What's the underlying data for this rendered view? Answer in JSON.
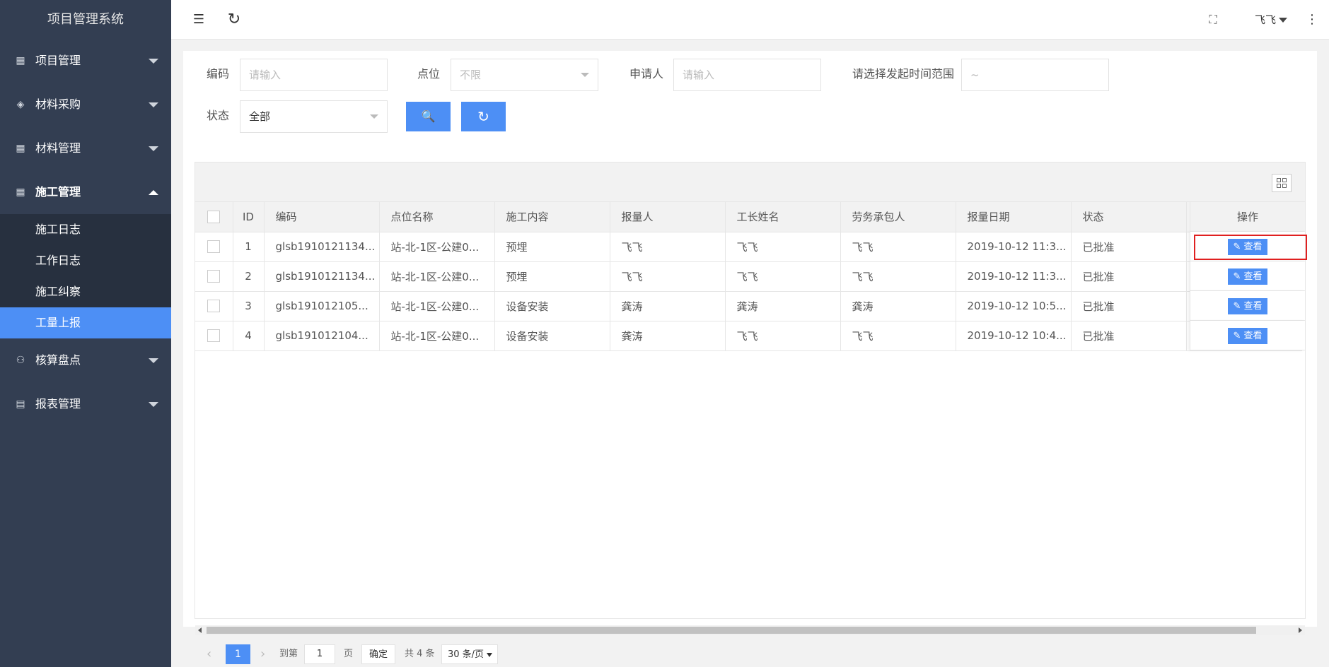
{
  "app": {
    "title": "项目管理系统"
  },
  "sidebar": {
    "menus": [
      {
        "label": "项目管理",
        "icon": "project-icon",
        "glyph": "▦",
        "open": false
      },
      {
        "label": "材料采购",
        "icon": "layers-icon",
        "glyph": "◈",
        "open": false
      },
      {
        "label": "材料管理",
        "icon": "material-icon",
        "glyph": "▦",
        "open": false
      },
      {
        "label": "施工管理",
        "icon": "construction-icon",
        "glyph": "▦",
        "open": true
      },
      {
        "label": "核算盘点",
        "icon": "user-icon",
        "glyph": "⚇",
        "open": false
      },
      {
        "label": "报表管理",
        "icon": "report-icon",
        "glyph": "▤",
        "open": false
      }
    ],
    "submenu": [
      "施工日志",
      "工作日志",
      "施工纠察",
      "工量上报"
    ],
    "active_sub": "工量上报"
  },
  "header": {
    "user": "飞飞",
    "menu_glyph": "☰",
    "refresh_glyph": "↻",
    "fullscreen_glyph": "⛶",
    "more_glyph": "⋮"
  },
  "filters": {
    "code": {
      "label": "编码",
      "placeholder": "请输入"
    },
    "point": {
      "label": "点位",
      "placeholder": "不限"
    },
    "applicant": {
      "label": "申请人",
      "placeholder": "请输入"
    },
    "time_range": {
      "label": "请选择发起时间范围",
      "placeholder": "~"
    },
    "status": {
      "label": "状态",
      "value": "全部"
    },
    "search_glyph": "🔍",
    "reset_glyph": "↻"
  },
  "table": {
    "headers": [
      "ID",
      "编码",
      "点位名称",
      "施工内容",
      "报量人",
      "工长姓名",
      "劳务承包人",
      "报量日期",
      "状态"
    ],
    "ops_header": "操作",
    "view_label": "查看",
    "rows": [
      {
        "id": "1",
        "code": "glsb1910121134...",
        "point": "站-北-1区-公建0...",
        "content": "预埋",
        "reporter": "飞飞",
        "foreman": "飞飞",
        "contractor": "飞飞",
        "date": "2019-10-12 11:3...",
        "status": "已批准"
      },
      {
        "id": "2",
        "code": "glsb1910121134...",
        "point": "站-北-1区-公建0...",
        "content": "预埋",
        "reporter": "飞飞",
        "foreman": "飞飞",
        "contractor": "飞飞",
        "date": "2019-10-12 11:3...",
        "status": "已批准"
      },
      {
        "id": "3",
        "code": "glsb191012105...",
        "point": "站-北-1区-公建0...",
        "content": "设备安装",
        "reporter": "龚涛",
        "foreman": "龚涛",
        "contractor": "龚涛",
        "date": "2019-10-12 10:5...",
        "status": "已批准"
      },
      {
        "id": "4",
        "code": "glsb191012104...",
        "point": "站-北-1区-公建0...",
        "content": "设备安装",
        "reporter": "龚涛",
        "foreman": "飞飞",
        "contractor": "飞飞",
        "date": "2019-10-12 10:4...",
        "status": "已批准"
      }
    ]
  },
  "pager": {
    "current": "1",
    "goto_label": "到第",
    "page_value": "1",
    "page_unit": "页",
    "confirm": "确定",
    "total": "共 4 条",
    "page_size": "30 条/页"
  },
  "colors": {
    "sidebar_bg": "#333e52",
    "accent": "#4d8ff5",
    "status_ok": "#2fbb3d",
    "highlight": "#e02020"
  }
}
